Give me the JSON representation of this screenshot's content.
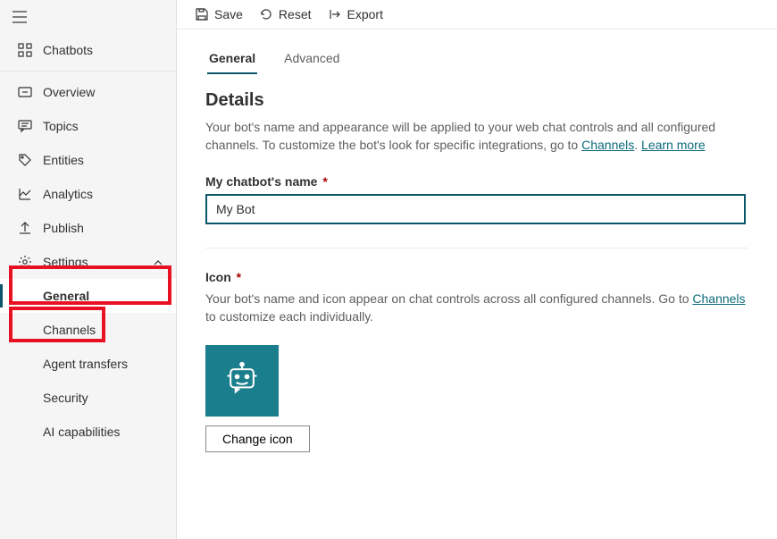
{
  "commandBar": {
    "save": "Save",
    "reset": "Reset",
    "export": "Export"
  },
  "sidebar": {
    "chatbots": "Chatbots",
    "overview": "Overview",
    "topics": "Topics",
    "entities": "Entities",
    "analytics": "Analytics",
    "publish": "Publish",
    "settings": "Settings",
    "subitems": {
      "general": "General",
      "channels": "Channels",
      "agentTransfers": "Agent transfers",
      "security": "Security",
      "aiCapabilities": "AI capabilities"
    }
  },
  "tabs": {
    "general": "General",
    "advanced": "Advanced"
  },
  "details": {
    "heading": "Details",
    "descPrefix": "Your bot's name and appearance will be applied to your web chat controls and all configured channels. To customize the bot's look for specific integrations, go to ",
    "channelsLink": "Channels",
    "descMid": ". ",
    "learnMore": "Learn more",
    "nameLabel": "My chatbot's name",
    "nameValue": "My Bot",
    "iconLabel": "Icon",
    "iconDescPrefix": "Your bot's name and icon appear on chat controls across all configured channels. Go to ",
    "iconDescSuffix": " to customize each individually.",
    "changeIcon": "Change icon"
  }
}
